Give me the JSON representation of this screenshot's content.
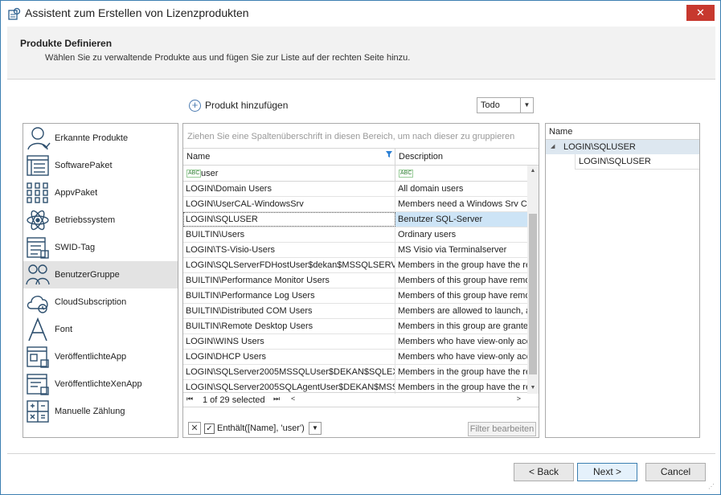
{
  "window": {
    "title": "Assistent zum Erstellen von Lizenzprodukten",
    "close_glyph": "✕"
  },
  "header": {
    "title": "Produkte Definieren",
    "subtitle": "Wählen Sie zu verwaltende Produkte aus und fügen Sie zur Liste auf der rechten Seite hinzu."
  },
  "toolbar": {
    "add_product_label": "Produkt hinzufügen",
    "todo_value": "Todo"
  },
  "nav": {
    "items": [
      {
        "label": "Erkannte Produkte",
        "icon": "detected-products-icon"
      },
      {
        "label": "SoftwarePaket",
        "icon": "software-package-icon"
      },
      {
        "label": "AppvPaket",
        "icon": "appv-package-icon"
      },
      {
        "label": "Betriebssystem",
        "icon": "operating-system-icon"
      },
      {
        "label": "SWID-Tag",
        "icon": "swid-tag-icon"
      },
      {
        "label": "BenutzerGruppe",
        "icon": "user-group-icon",
        "active": true
      },
      {
        "label": "CloudSubscription",
        "icon": "cloud-subscription-icon"
      },
      {
        "label": "Font",
        "icon": "font-icon"
      },
      {
        "label": "VeröffentlichteApp",
        "icon": "published-app-icon"
      },
      {
        "label": "VeröffentlichteXenApp",
        "icon": "published-xenapp-icon"
      },
      {
        "label": "Manuelle Zählung",
        "icon": "calculator-icon"
      }
    ]
  },
  "grid": {
    "group_hint": "Ziehen Sie eine Spaltenüberschrift in diesen Bereich, um nach dieser zu gruppieren",
    "columns": {
      "name": "Name",
      "description": "Description"
    },
    "filter": {
      "name_value": "user",
      "abc_badge": "ABC"
    },
    "rows": [
      {
        "name": "LOGIN\\Domain Users",
        "description": "All domain users"
      },
      {
        "name": "LOGIN\\UserCAL-WindowsSrv",
        "description": "Members need a Windows Srv CAL"
      },
      {
        "name": "LOGIN\\SQLUSER",
        "description": "Benutzer SQL-Server",
        "selected": true
      },
      {
        "name": "BUILTIN\\Users",
        "description": "Ordinary users"
      },
      {
        "name": "LOGIN\\TS-Visio-Users",
        "description": "MS Visio via Terminalserver"
      },
      {
        "name": "LOGIN\\SQLServerFDHostUser$dekan$MSSQLSERVER",
        "description": "Members in the group have the re"
      },
      {
        "name": "BUILTIN\\Performance Monitor Users",
        "description": "Members of this group have remo"
      },
      {
        "name": "BUILTIN\\Performance Log Users",
        "description": "Members of this group have remo"
      },
      {
        "name": "BUILTIN\\Distributed COM Users",
        "description": "Members are allowed to launch, a"
      },
      {
        "name": "BUILTIN\\Remote Desktop Users",
        "description": "Members in this group are grante"
      },
      {
        "name": "LOGIN\\WINS Users",
        "description": "Members who have view-only acc"
      },
      {
        "name": "LOGIN\\DHCP Users",
        "description": "Members who have view-only acc"
      },
      {
        "name": "LOGIN\\SQLServer2005MSSQLUser$DEKAN$SQLEX...",
        "description": "Members in the group have the re"
      },
      {
        "name": "LOGIN\\SQLServer2005SQLAgentUser$DEKAN$MSS...",
        "description": "Members in the group have the re"
      }
    ],
    "navigator": {
      "record_text": "1 of 29 selected",
      "first": "⏮",
      "last": "⏭",
      "left": "<",
      "right": ">"
    },
    "filter_panel": {
      "expression": "Enthält([Name], 'user')",
      "edit_label": "Filter bearbeiten"
    }
  },
  "right_panel": {
    "header": "Name",
    "group": "LOGIN\\SQLUSER",
    "child": "LOGIN\\SQLUSER"
  },
  "footer": {
    "back": "< Back",
    "next": "Next >",
    "cancel": "Cancel"
  }
}
